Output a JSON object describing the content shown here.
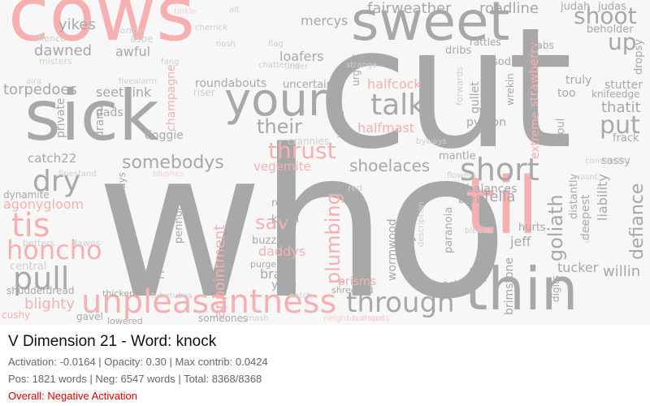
{
  "panel": {
    "title": "V Dimension 21 - Word: knock",
    "stats_line": "Activation: -0.0164 | Opacity: 0.30 | Max contrib: 0.0424",
    "counts_line": "Pos: 1821 words | Neg: 6547 words | Total: 8368/8368",
    "overall": "Overall: Negative Activation",
    "overall_color": "#e00000"
  },
  "colors": {
    "positive": "#a8a8a8",
    "negative": "#f6b0b0"
  },
  "words": [
    "cows",
    "who",
    "cut",
    "sick",
    "sweet",
    "your",
    "thin",
    "til",
    "unpleasantness",
    "through",
    "honcho",
    "pull",
    "tis",
    "short",
    "dry",
    "talk",
    "shoot",
    "put",
    "up",
    "thrust",
    "somebodys",
    "shoelaces",
    "their",
    "goliath",
    "defiance",
    "plumbing",
    "sav",
    "appointment",
    "charybdis",
    "wormwood",
    "fairweather",
    "roadline",
    "yikes",
    "dawned",
    "awful",
    "halfcock",
    "halfmast",
    "mercys",
    "loafers",
    "roundabouts",
    "seethink",
    "champagne",
    "torpedoes",
    "catch22",
    "agonygloom",
    "blighty",
    "dynamite",
    "vegemite",
    "crannies",
    "python",
    "union",
    "gullet",
    "strawberry",
    "extreme",
    "jeff",
    "fella",
    "balances",
    "liability",
    "stutter",
    "knifeedge",
    "thatit",
    "deepest",
    "brimstone",
    "tucker",
    "willin",
    "arts",
    "prisms",
    "daddys",
    "bray",
    "yore",
    "rec",
    "buzzard",
    "khazi",
    "rede",
    "doggie",
    "dads",
    "drama",
    "private",
    "truly",
    "too",
    "frack",
    "sassy",
    "mantle",
    "burl",
    "hurts",
    "dribs",
    "sods",
    "judah",
    "judas",
    "beholder",
    "dropsy",
    "afoul",
    "distantly",
    "paranoia",
    "pennorth",
    "holidays",
    "purge",
    "someones",
    "uncertain",
    "riser",
    "rattles",
    "drabs",
    "shredded",
    "thickens",
    "lowered",
    "gavel",
    "cushy",
    "betters",
    "central",
    "dawns",
    "shudderdread",
    "fivealarm",
    "sorrow",
    "asbe",
    "misters",
    "offence",
    "aira",
    "finestand",
    "blushes",
    "under",
    "flowers",
    "red",
    "digits",
    "wrekin",
    "voting",
    "smash",
    "neighbourhood",
    "trumpets",
    "chattering",
    "strange",
    "urgent",
    "forwards",
    "byways",
    "natch",
    "tubetubes",
    "convention",
    "wasnt",
    "unsaid",
    "description",
    "bleeds",
    "tinkle",
    "cherrick",
    "nosh",
    "alt",
    "fang",
    "flag",
    "scissors"
  ]
}
